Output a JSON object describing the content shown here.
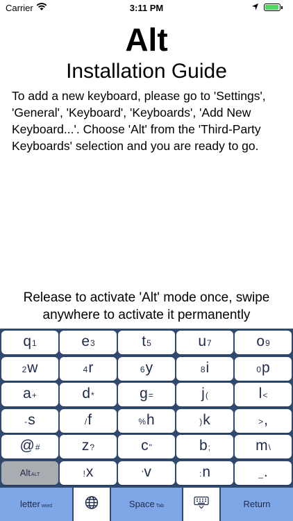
{
  "status_bar": {
    "carrier": "Carrier",
    "time": "3:11 PM"
  },
  "app": {
    "title": "Alt",
    "subtitle": "Installation Guide",
    "guide": "To add a new keyboard, please go to 'Settings', 'General', 'Keyboard', 'Keyboards', 'Add New Keyboard...'. Choose 'Alt' from the 'Third-Party Keyboards' selection and you are ready to go.",
    "hint": "Release to activate 'Alt' mode once, swipe anywhere to activate it permanently"
  },
  "keyboard": {
    "rows": [
      [
        {
          "pre": "",
          "main": "q",
          "sub": "1"
        },
        {
          "pre": "",
          "main": "e",
          "sub": "3"
        },
        {
          "pre": "",
          "main": "t",
          "sub": "5"
        },
        {
          "pre": "",
          "main": "u",
          "sub": "7"
        },
        {
          "pre": "",
          "main": "o",
          "sub": "9"
        }
      ],
      [
        {
          "pre": "2",
          "main": "w",
          "sub": ""
        },
        {
          "pre": "4",
          "main": "r",
          "sub": ""
        },
        {
          "pre": "6",
          "main": "y",
          "sub": ""
        },
        {
          "pre": "8",
          "main": "i",
          "sub": ""
        },
        {
          "pre": "0",
          "main": "p",
          "sub": ""
        }
      ],
      [
        {
          "pre": "",
          "main": "a",
          "sub": "+"
        },
        {
          "pre": "",
          "main": "d",
          "sub": "*"
        },
        {
          "pre": "",
          "main": "g",
          "sub": "="
        },
        {
          "pre": "",
          "main": "j",
          "sub": "("
        },
        {
          "pre": "",
          "main": "l",
          "sub": "<"
        }
      ],
      [
        {
          "pre": "-",
          "main": "s",
          "sub": ""
        },
        {
          "pre": "/",
          "main": "f",
          "sub": ""
        },
        {
          "pre": "%",
          "main": "h",
          "sub": ""
        },
        {
          "pre": ")",
          "main": "k",
          "sub": ""
        },
        {
          "pre": ">",
          "main": ",",
          "sub": ""
        }
      ],
      [
        {
          "pre": "",
          "main": "@",
          "sub": "#"
        },
        {
          "pre": "",
          "main": "z",
          "sub": "?"
        },
        {
          "pre": "",
          "main": "c",
          "sub": "\""
        },
        {
          "pre": "",
          "main": "b",
          "sub": ";"
        },
        {
          "pre": "",
          "main": "m",
          "sub": "\\"
        }
      ],
      [
        {
          "pre": "",
          "main": "Alt",
          "sub": "ALT",
          "dark": true
        },
        {
          "pre": "!",
          "main": "x",
          "sub": ""
        },
        {
          "pre": "'",
          "main": "v",
          "sub": ""
        },
        {
          "pre": ":",
          "main": "n",
          "sub": ""
        },
        {
          "pre": "_",
          "main": ".",
          "sub": ""
        }
      ]
    ],
    "bottom": {
      "letter_label": "letter",
      "letter_sub": "word",
      "space_label": "Space",
      "space_sub": "Tab",
      "return_label": "Return"
    }
  },
  "colors": {
    "keyboard_bg": "#2f4a6e",
    "accent_key": "#7fa7e8",
    "alt_key": "#a9acb1",
    "battery": "#4cd964"
  },
  "icons": [
    "wifi-icon",
    "location-icon",
    "battery-icon",
    "globe-icon",
    "keyboard-icon"
  ]
}
